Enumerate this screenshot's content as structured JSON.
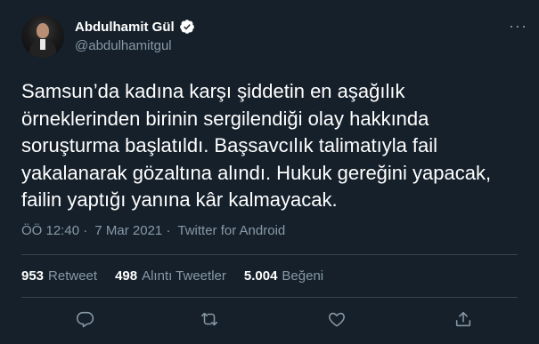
{
  "author": {
    "name": "Abdulhamit Gül",
    "handle": "@abdulhamitgul"
  },
  "tweet": {
    "text": "Samsun’da kadına karşı şiddetin en aşağılık\nörneklerinden birinin sergilendiği olay hakkında\nsoruşturma başlatıldı. Başsavcılık talimatıyla fail\nyakalanarak gözaltına alındı. Hukuk gereğini yapacak,\nfailin yaptığı yanına kâr kalmayacak.",
    "time": "ÖÖ 12:40",
    "date": "7 Mar 2021",
    "separator": "·",
    "source": "Twitter for Android"
  },
  "stats": {
    "retweets_count": "953",
    "retweets_label": "Retweet",
    "quotes_count": "498",
    "quotes_label": "Alıntı Tweetler",
    "likes_count": "5.004",
    "likes_label": "Beğeni"
  },
  "icons": {
    "verified": "verified-badge-icon",
    "more": "more-options-icon",
    "reply": "reply-icon",
    "retweet": "retweet-icon",
    "like": "heart-icon",
    "share": "share-icon"
  },
  "colors": {
    "background": "#15202b",
    "accent": "#1da1f2",
    "muted": "#8899a6",
    "divider": "#38444d"
  }
}
